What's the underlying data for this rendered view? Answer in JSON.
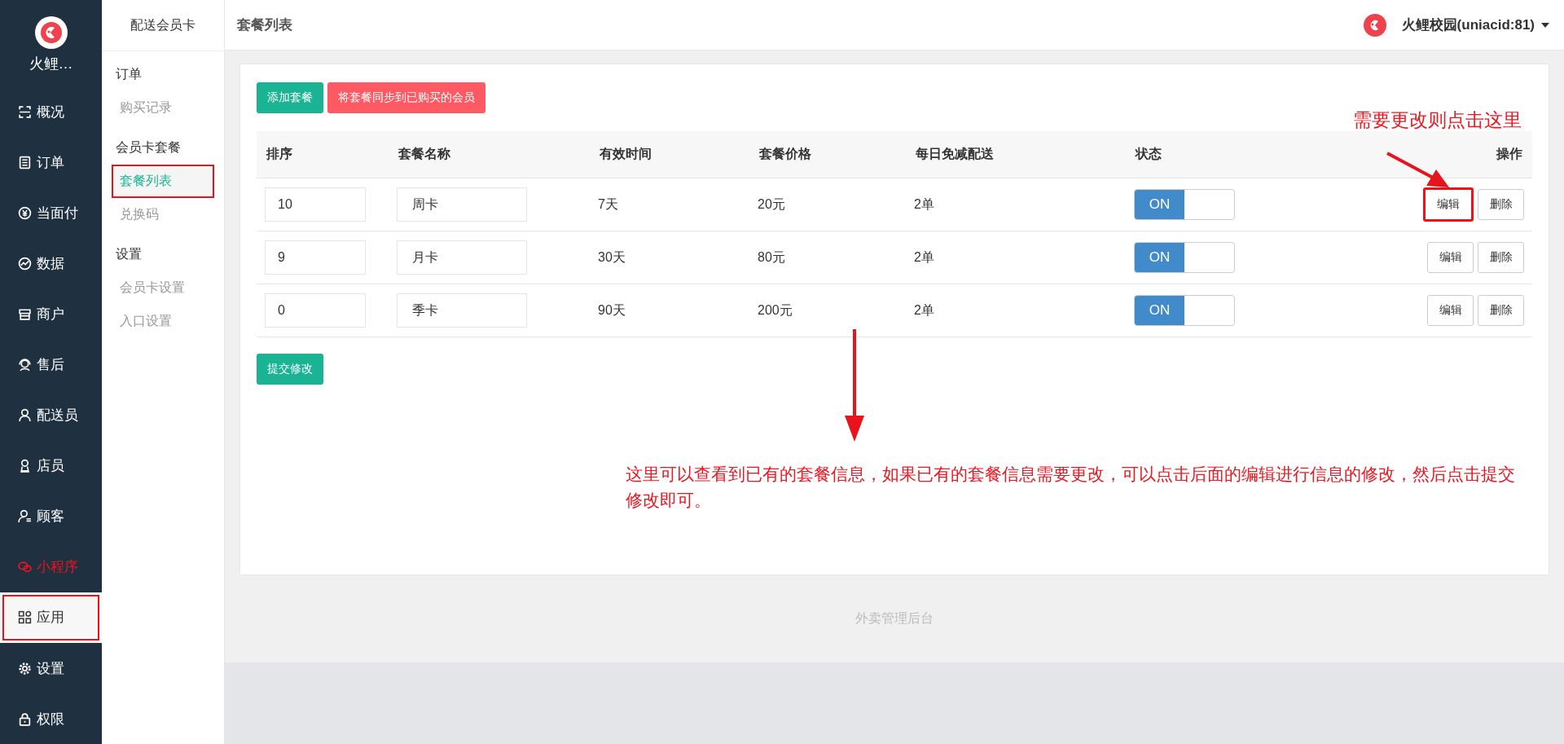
{
  "sidebar": {
    "brand": "火鲤…",
    "items": [
      {
        "label": "概况",
        "selected": false,
        "alert": false,
        "highlighted": false
      },
      {
        "label": "订单",
        "selected": false,
        "alert": false,
        "highlighted": false
      },
      {
        "label": "当面付",
        "selected": false,
        "alert": false,
        "highlighted": false
      },
      {
        "label": "数据",
        "selected": false,
        "alert": false,
        "highlighted": false
      },
      {
        "label": "商户",
        "selected": false,
        "alert": false,
        "highlighted": false
      },
      {
        "label": "售后",
        "selected": false,
        "alert": false,
        "highlighted": false
      },
      {
        "label": "配送员",
        "selected": false,
        "alert": false,
        "highlighted": false
      },
      {
        "label": "店员",
        "selected": false,
        "alert": false,
        "highlighted": false
      },
      {
        "label": "顾客",
        "selected": false,
        "alert": false,
        "highlighted": false
      },
      {
        "label": "小程序",
        "selected": false,
        "alert": true,
        "highlighted": false
      },
      {
        "label": "应用",
        "selected": true,
        "alert": false,
        "highlighted": true
      },
      {
        "label": "设置",
        "selected": false,
        "alert": false,
        "highlighted": false
      },
      {
        "label": "权限",
        "selected": false,
        "alert": false,
        "highlighted": false
      }
    ]
  },
  "subnav": {
    "title": "配送会员卡",
    "groups": [
      {
        "heading": "订单",
        "items": [
          {
            "label": "购买记录",
            "selected": false,
            "highlighted": false
          }
        ]
      },
      {
        "heading": "会员卡套餐",
        "items": [
          {
            "label": "套餐列表",
            "selected": true,
            "highlighted": true
          },
          {
            "label": "兑换码",
            "selected": false,
            "highlighted": false
          }
        ]
      },
      {
        "heading": "设置",
        "items": [
          {
            "label": "会员卡设置",
            "selected": false,
            "highlighted": false
          },
          {
            "label": "入口设置",
            "selected": false,
            "highlighted": false
          }
        ]
      }
    ]
  },
  "header": {
    "title": "套餐列表",
    "account": "火鲤校园(uniacid:81)"
  },
  "toolbar": {
    "add_button": "添加套餐",
    "sync_button": "将套餐同步到已购买的会员"
  },
  "table": {
    "columns": [
      "排序",
      "套餐名称",
      "有效时间",
      "套餐价格",
      "每日免减配送",
      "状态",
      "操作"
    ],
    "rows": [
      {
        "sort": "10",
        "name": "周卡",
        "duration": "7天",
        "price": "20元",
        "daily": "2单",
        "status": {
          "label": "ON",
          "on": true
        },
        "edit": "编辑",
        "delete": "删除",
        "edit_highlighted": true
      },
      {
        "sort": "9",
        "name": "月卡",
        "duration": "30天",
        "price": "80元",
        "daily": "2单",
        "status": {
          "label": "ON",
          "on": true
        },
        "edit": "编辑",
        "delete": "删除",
        "edit_highlighted": false
      },
      {
        "sort": "0",
        "name": "季卡",
        "duration": "90天",
        "price": "200元",
        "daily": "2单",
        "status": {
          "label": "ON",
          "on": true
        },
        "edit": "编辑",
        "delete": "删除",
        "edit_highlighted": false
      }
    ]
  },
  "submit_button": "提交修改",
  "annotations": {
    "edit_hint": "需要更改则点击这里",
    "info_hint": "这里可以查看到已有的套餐信息，如果已有的套餐信息需要更改，可以点击后面的编辑进行信息的修改，然后点击提交修改即可。"
  },
  "footer": "外卖管理后台"
}
